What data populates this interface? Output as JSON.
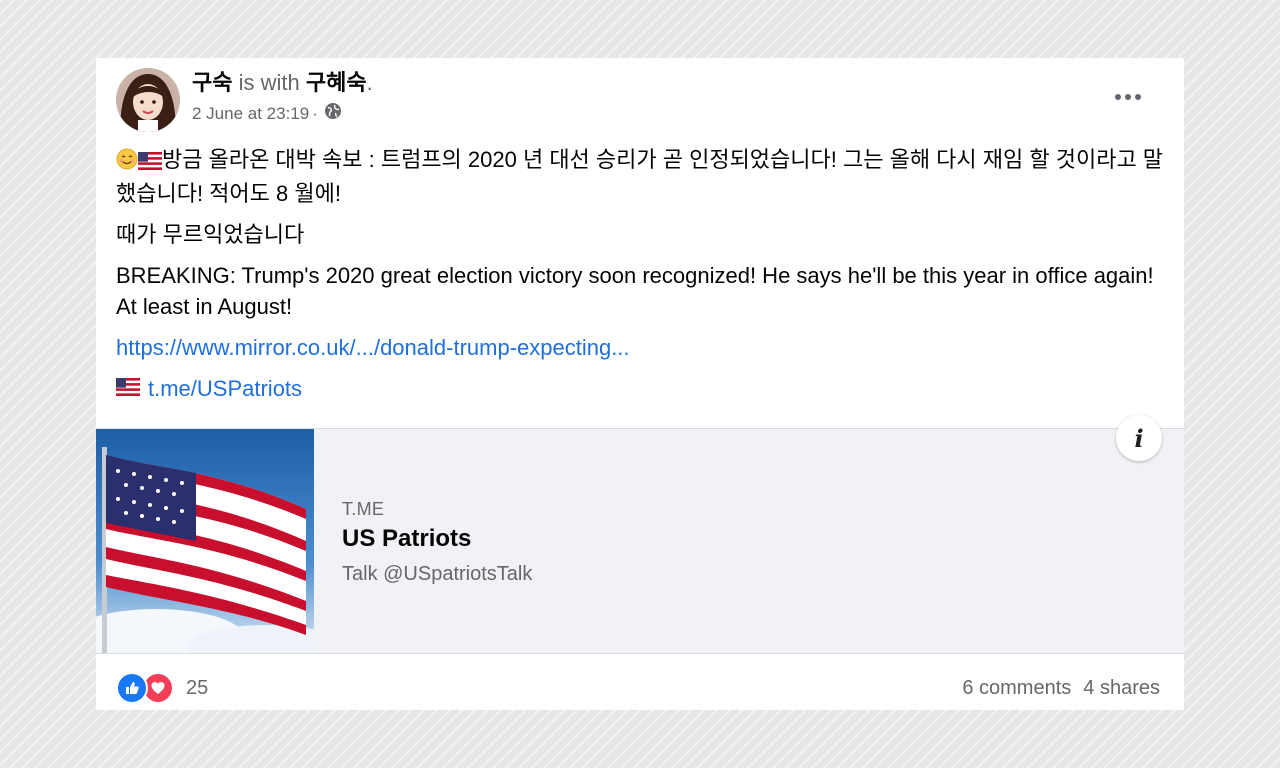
{
  "post": {
    "author": "구숙",
    "with_text": "is with",
    "tagged": "구혜숙",
    "tagged_suffix": ".",
    "timestamp": "2 June at 23:19",
    "separator": "·",
    "privacy_icon": "globe-icon",
    "more_icon": "more-options-icon",
    "text_korean_line1": "방금 올라온 대박 속보 : 트럼프의 2020 년 대선 승리가 곧 인정되었습니다! 그는 올해 다시 재임 할 것이라고 말했습니다! 적어도 8 월에!",
    "text_korean_line2": "때가 무르익었습니다",
    "text_english": "BREAKING: Trump's 2020 great election victory soon recognized! He says he'll be this year in office again! At least in August!",
    "link_url": "https://www.mirror.co.uk/.../donald-trump-expecting...",
    "tme_link": "t.me/USPatriots",
    "emoji_icons": [
      "smiling-face-icon",
      "us-flag-icon"
    ]
  },
  "preview": {
    "domain": "T.ME",
    "title": "US Patriots",
    "subtitle": "Talk @USpatriotsTalk",
    "info_label": "i"
  },
  "footer": {
    "reaction_count": "25",
    "comments": "6 comments",
    "shares": "4 shares"
  },
  "colors": {
    "link": "#216fdb",
    "like": "#1877f2",
    "love": "#f33e58",
    "muted": "#65676b"
  }
}
